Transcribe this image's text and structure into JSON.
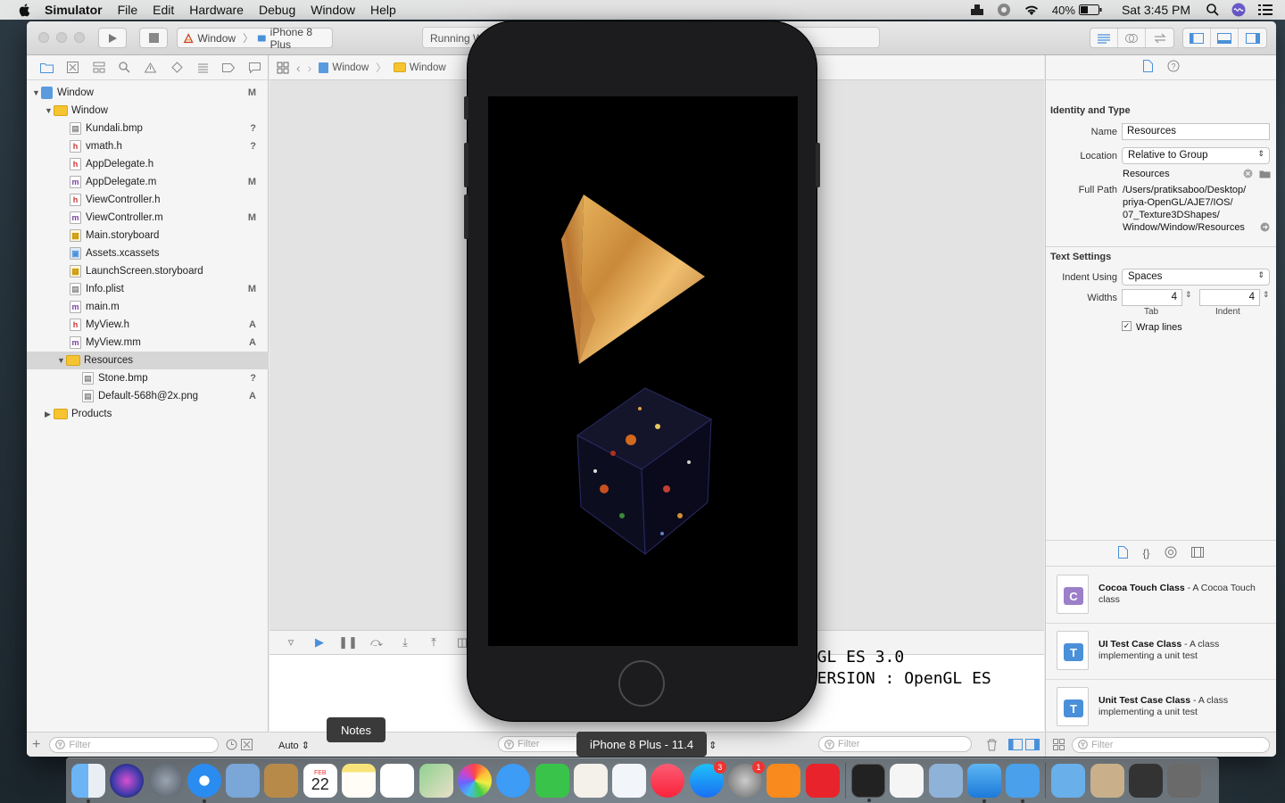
{
  "menubar": {
    "app": "Simulator",
    "items": [
      "File",
      "Edit",
      "Hardware",
      "Debug",
      "Window",
      "Help"
    ],
    "battery": "40%",
    "clock": "Sat 3:45 PM"
  },
  "toolbar": {
    "scheme_target": "Window",
    "scheme_device": "iPhone 8 Plus",
    "activity": "Running W"
  },
  "navigator": {
    "items": [
      {
        "label": "Window",
        "status": "M"
      },
      {
        "label": "Window",
        "status": ""
      },
      {
        "label": "Kundali.bmp",
        "status": "?"
      },
      {
        "label": "vmath.h",
        "status": "?"
      },
      {
        "label": "AppDelegate.h",
        "status": ""
      },
      {
        "label": "AppDelegate.m",
        "status": "M"
      },
      {
        "label": "ViewController.h",
        "status": ""
      },
      {
        "label": "ViewController.m",
        "status": "M"
      },
      {
        "label": "Main.storyboard",
        "status": ""
      },
      {
        "label": "Assets.xcassets",
        "status": ""
      },
      {
        "label": "LaunchScreen.storyboard",
        "status": ""
      },
      {
        "label": "Info.plist",
        "status": "M"
      },
      {
        "label": "main.m",
        "status": ""
      },
      {
        "label": "MyView.h",
        "status": "A"
      },
      {
        "label": "MyView.mm",
        "status": "A"
      },
      {
        "label": "Resources",
        "status": ""
      },
      {
        "label": "Stone.bmp",
        "status": "?"
      },
      {
        "label": "Default-568h@2x.png",
        "status": "A"
      },
      {
        "label": "Products",
        "status": ""
      }
    ],
    "filter_placeholder": "Filter"
  },
  "jumpbar": {
    "crumbs": [
      "Window",
      "Window"
    ]
  },
  "console": {
    "line1": "enGL ES 3.0",
    "line2": "_VERSION : OpenGL ES",
    "auto_label": "Auto",
    "filter_placeholder": "Filter",
    "filter2_placeholder": "Filter",
    "scope_fragment": "t"
  },
  "inspector": {
    "identity_title": "Identity and Type",
    "name_label": "Name",
    "name_value": "Resources",
    "location_label": "Location",
    "location_value": "Relative to Group",
    "location_sub": "Resources",
    "fullpath_label": "Full Path",
    "fullpath_lines": [
      "/Users/pratiksaboo/Desktop/",
      "priya-OpenGL/AJE7/IOS/",
      "07_Texture3DShapes/",
      "Window/Window/Resources"
    ],
    "text_settings_title": "Text Settings",
    "indent_label": "Indent Using",
    "indent_value": "Spaces",
    "widths_label": "Widths",
    "tab_value": "4",
    "indent_width_value": "4",
    "tab_caption": "Tab",
    "indent_caption": "Indent",
    "wrap_label": "Wrap lines",
    "library": [
      {
        "title": "Cocoa Touch Class",
        "desc": " - A Cocoa Touch class",
        "letter": "C",
        "color": "#9b7fc8"
      },
      {
        "title": "UI Test Case Class",
        "desc": " - A class implementing a unit test",
        "letter": "T",
        "color": "#4a90d9"
      },
      {
        "title": "Unit Test Case Class",
        "desc": " - A class implementing a unit test",
        "letter": "T",
        "color": "#4a90d9"
      }
    ],
    "filter_placeholder": "Filter"
  },
  "tooltips": {
    "notes": "Notes",
    "simulator": "iPhone 8 Plus - 11.4"
  },
  "dock": {
    "calendar_month": "FEB",
    "calendar_day": "22",
    "appstore_badge": "3",
    "prefs_badge": "1"
  }
}
